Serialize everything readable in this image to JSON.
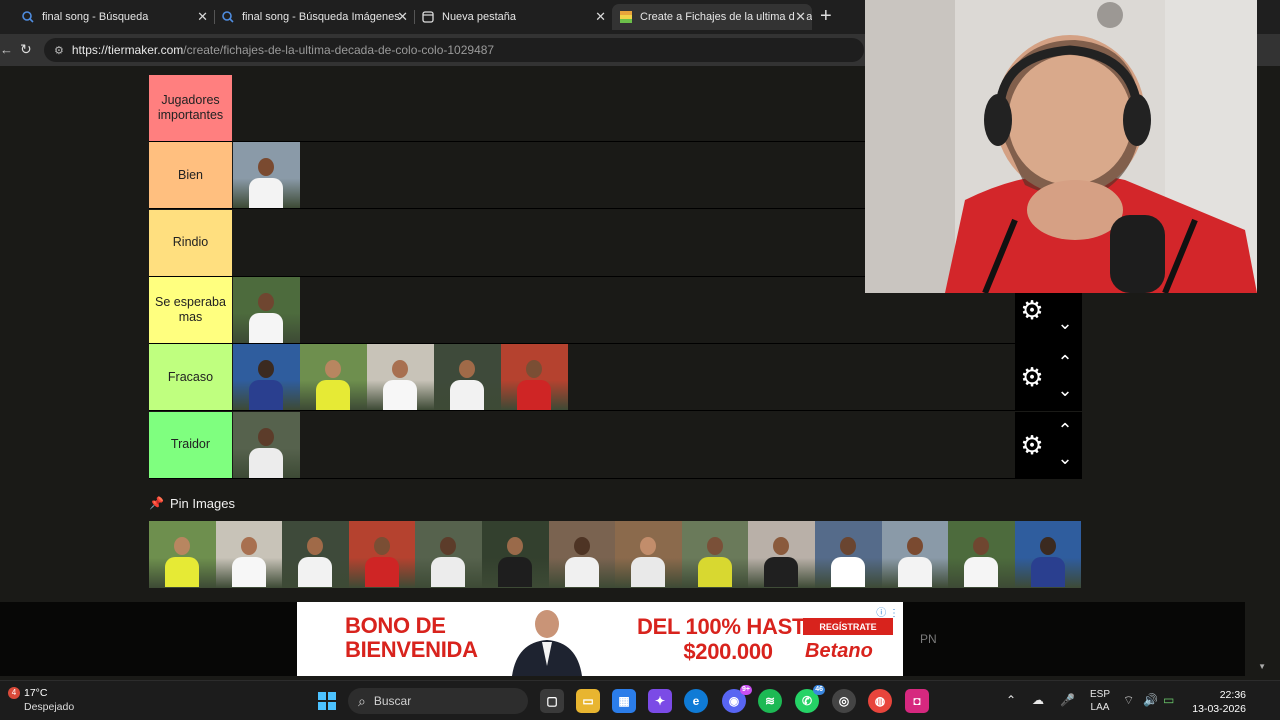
{
  "browser": {
    "tabs": [
      {
        "title": "final song - Búsqueda",
        "active": false
      },
      {
        "title": "final song - Búsqueda Imágenes",
        "active": false
      },
      {
        "title": "Nueva pestaña",
        "active": false
      },
      {
        "title": "Create a Fichajes de la ultima deca",
        "active": true
      }
    ],
    "url_domain": "https://tiermaker.com",
    "url_path": "/create/fichajes-de-la-ultima-decada-de-colo-colo-1029487"
  },
  "tiers": [
    {
      "label": "Jugadores importantes",
      "color": "#ff7f7f",
      "items": 0
    },
    {
      "label": "Bien",
      "color": "#ffbf7f",
      "items": 1
    },
    {
      "label": "Rindio",
      "color": "#ffdf7f",
      "items": 0
    },
    {
      "label": "Se esperaba mas",
      "color": "#ffff7f",
      "items": 1
    },
    {
      "label": "Fracaso",
      "color": "#bfff7f",
      "items": 5
    },
    {
      "label": "Traidor",
      "color": "#7fff7f",
      "items": 1
    }
  ],
  "pin_images": {
    "label": "Pin Images",
    "count": 14
  },
  "ad": {
    "line1": "BONO DE",
    "line2": "BIENVENIDA",
    "line3": "DEL 100% HASTA",
    "line4": "$200.000",
    "cta": "REGÍSTRATE",
    "brand": "Betano"
  },
  "pn_label": "PN",
  "taskbar": {
    "weather_badge": "4",
    "temperature": "17°C",
    "condition": "Despejado",
    "search_placeholder": "Buscar",
    "discord_badge": "9+",
    "whatsapp_badge": "46",
    "lang_top": "ESP",
    "lang_bottom": "LAA",
    "time": "22:36",
    "date": "13-03-2026"
  }
}
